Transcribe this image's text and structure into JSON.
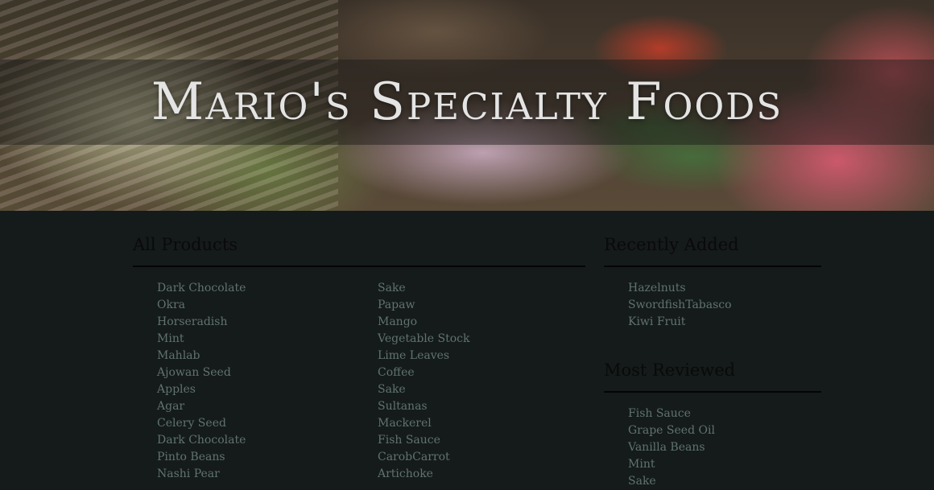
{
  "site": {
    "title": "Mario's Specialty Foods"
  },
  "all_products": {
    "heading": "All Products",
    "left_column": [
      "Dark Chocolate",
      "Okra",
      "Horseradish",
      "Mint",
      "Mahlab",
      "Ajowan Seed",
      "Apples",
      "Agar",
      "Celery Seed",
      "Dark Chocolate",
      "Pinto Beans",
      "Nashi Pear"
    ],
    "right_column": [
      "Sake",
      "Papaw",
      "Mango",
      "Vegetable Stock",
      "Lime Leaves",
      "Coffee",
      "Sake",
      "Sultanas",
      "Mackerel",
      "Fish Sauce",
      "CarobCarrot",
      "Artichoke"
    ]
  },
  "recently_added": {
    "heading": "Recently Added",
    "items": [
      "Hazelnuts",
      "SwordfishTabasco",
      "Kiwi Fruit"
    ]
  },
  "most_reviewed": {
    "heading": "Most Reviewed",
    "items": [
      "Fish Sauce",
      "Grape Seed Oil",
      "Vanilla Beans",
      "Mint",
      "Sake"
    ]
  }
}
